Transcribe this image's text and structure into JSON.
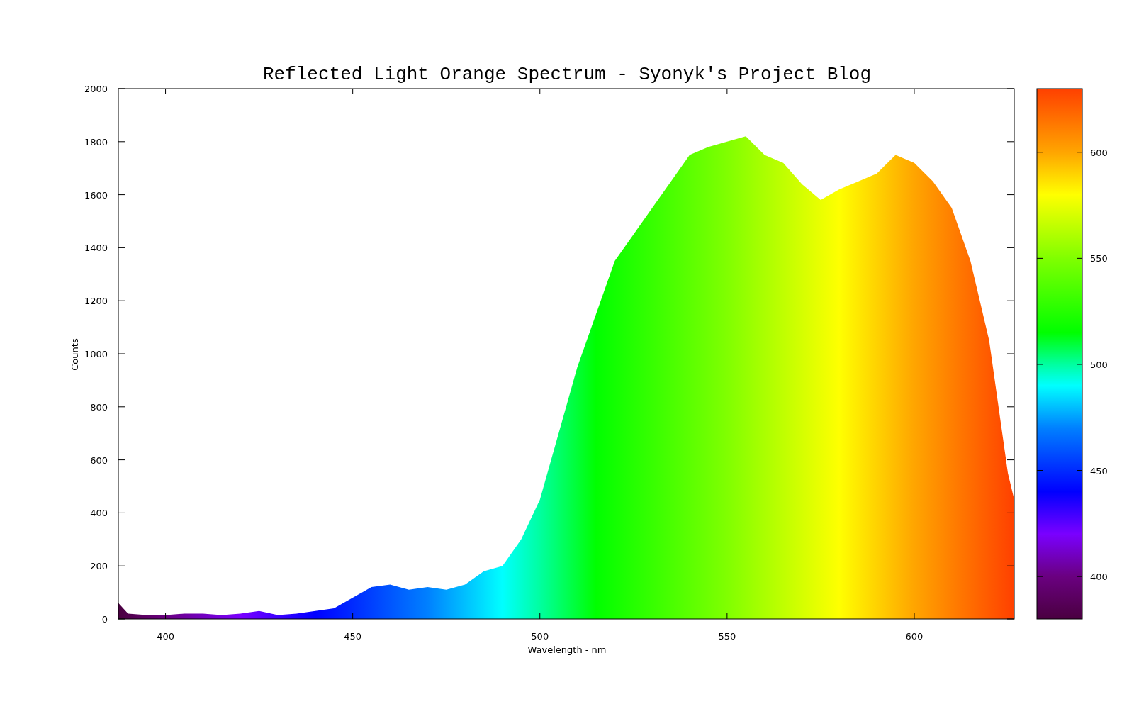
{
  "chart": {
    "chart_data": {
      "type": "area",
      "title": "Reflected Light Orange Spectrum - Syonyk's Project Blog",
      "xlabel": "Wavelength - nm",
      "ylabel": "Counts",
      "x": [
        387.4,
        390,
        395,
        400,
        405,
        410,
        415,
        420,
        425,
        430,
        435,
        440,
        445,
        450,
        455,
        460,
        465,
        470,
        475,
        480,
        485,
        490,
        495,
        500,
        505,
        510,
        515,
        520,
        525,
        530,
        535,
        540,
        545,
        550,
        555,
        560,
        565,
        570,
        575,
        580,
        585,
        590,
        595,
        600,
        605,
        610,
        615,
        620,
        625,
        626.7
      ],
      "series": [
        {
          "values": [
            60,
            20,
            15,
            15,
            20,
            20,
            15,
            20,
            30,
            15,
            20,
            30,
            40,
            80,
            120,
            130,
            110,
            120,
            110,
            130,
            180,
            200,
            300,
            450,
            700,
            950,
            1150,
            1350,
            1450,
            1550,
            1650,
            1750,
            1780,
            1800,
            1820,
            1750,
            1720,
            1640,
            1580,
            1620,
            1650,
            1680,
            1750,
            1720,
            1650,
            1550,
            1350,
            1050,
            550,
            450
          ]
        }
      ],
      "xlim": [
        387.4,
        626.7
      ],
      "ylim": [
        0,
        2000
      ],
      "xticks": [
        400,
        450,
        500,
        550,
        600
      ],
      "yticks": [
        0,
        200,
        400,
        600,
        800,
        1000,
        1200,
        1400,
        1600,
        1800,
        2000
      ]
    },
    "colorbar": {
      "ticks": [
        "600",
        "550",
        "500",
        "450",
        "400"
      ]
    }
  }
}
